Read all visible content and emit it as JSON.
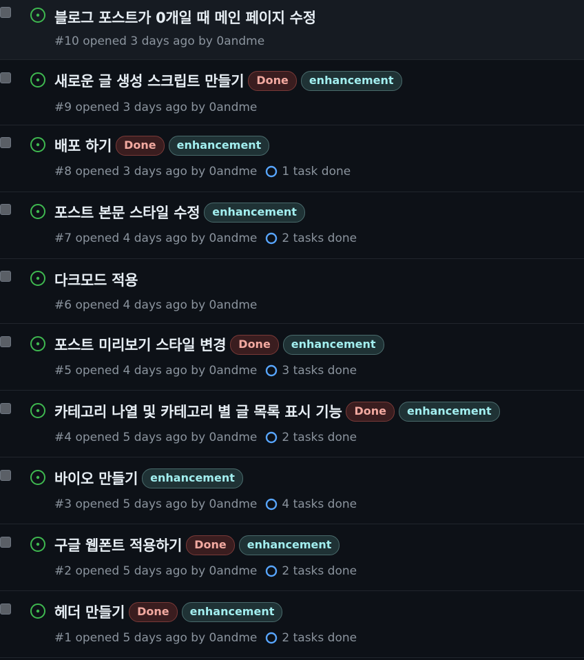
{
  "colors": {
    "background": "#0d1117",
    "open_icon": "#3fb950",
    "task_icon": "#58a6ff",
    "done_label_text": "#f2a9a0",
    "enhancement_label_text": "#a2eeef"
  },
  "issues": [
    {
      "title": "블로그 포스트가 0개일 때 메인 페이지 수정",
      "labels": [],
      "meta": "#10 opened 3 days ago by 0andme",
      "tasks": ""
    },
    {
      "title": "새로운 글 생성 스크립트 만들기",
      "labels": [
        "Done",
        "enhancement"
      ],
      "meta": "#9 opened 3 days ago by 0andme",
      "tasks": ""
    },
    {
      "title": "배포 하기",
      "labels": [
        "Done",
        "enhancement"
      ],
      "meta": "#8 opened 3 days ago by 0andme",
      "tasks": "1 task done"
    },
    {
      "title": "포스트 본문 스타일 수정",
      "labels": [
        "enhancement"
      ],
      "meta": "#7 opened 4 days ago by 0andme",
      "tasks": "2 tasks done"
    },
    {
      "title": "다크모드 적용",
      "labels": [],
      "meta": "#6 opened 4 days ago by 0andme",
      "tasks": ""
    },
    {
      "title": "포스트 미리보기 스타일 변경",
      "labels": [
        "Done",
        "enhancement"
      ],
      "meta": "#5 opened 4 days ago by 0andme",
      "tasks": "3 tasks done"
    },
    {
      "title": "카테고리 나열 및 카테고리 별 글 목록 표시 기능",
      "labels": [
        "Done",
        "enhancement"
      ],
      "meta": "#4 opened 5 days ago by 0andme",
      "tasks": "2 tasks done"
    },
    {
      "title": "바이오 만들기",
      "labels": [
        "enhancement"
      ],
      "meta": "#3 opened 5 days ago by 0andme",
      "tasks": "4 tasks done"
    },
    {
      "title": "구글 웹폰트 적용하기",
      "labels": [
        "Done",
        "enhancement"
      ],
      "meta": "#2 opened 5 days ago by 0andme",
      "tasks": "2 tasks done"
    },
    {
      "title": "헤더 만들기",
      "labels": [
        "Done",
        "enhancement"
      ],
      "meta": "#1 opened 5 days ago by 0andme",
      "tasks": "2 tasks done"
    }
  ]
}
